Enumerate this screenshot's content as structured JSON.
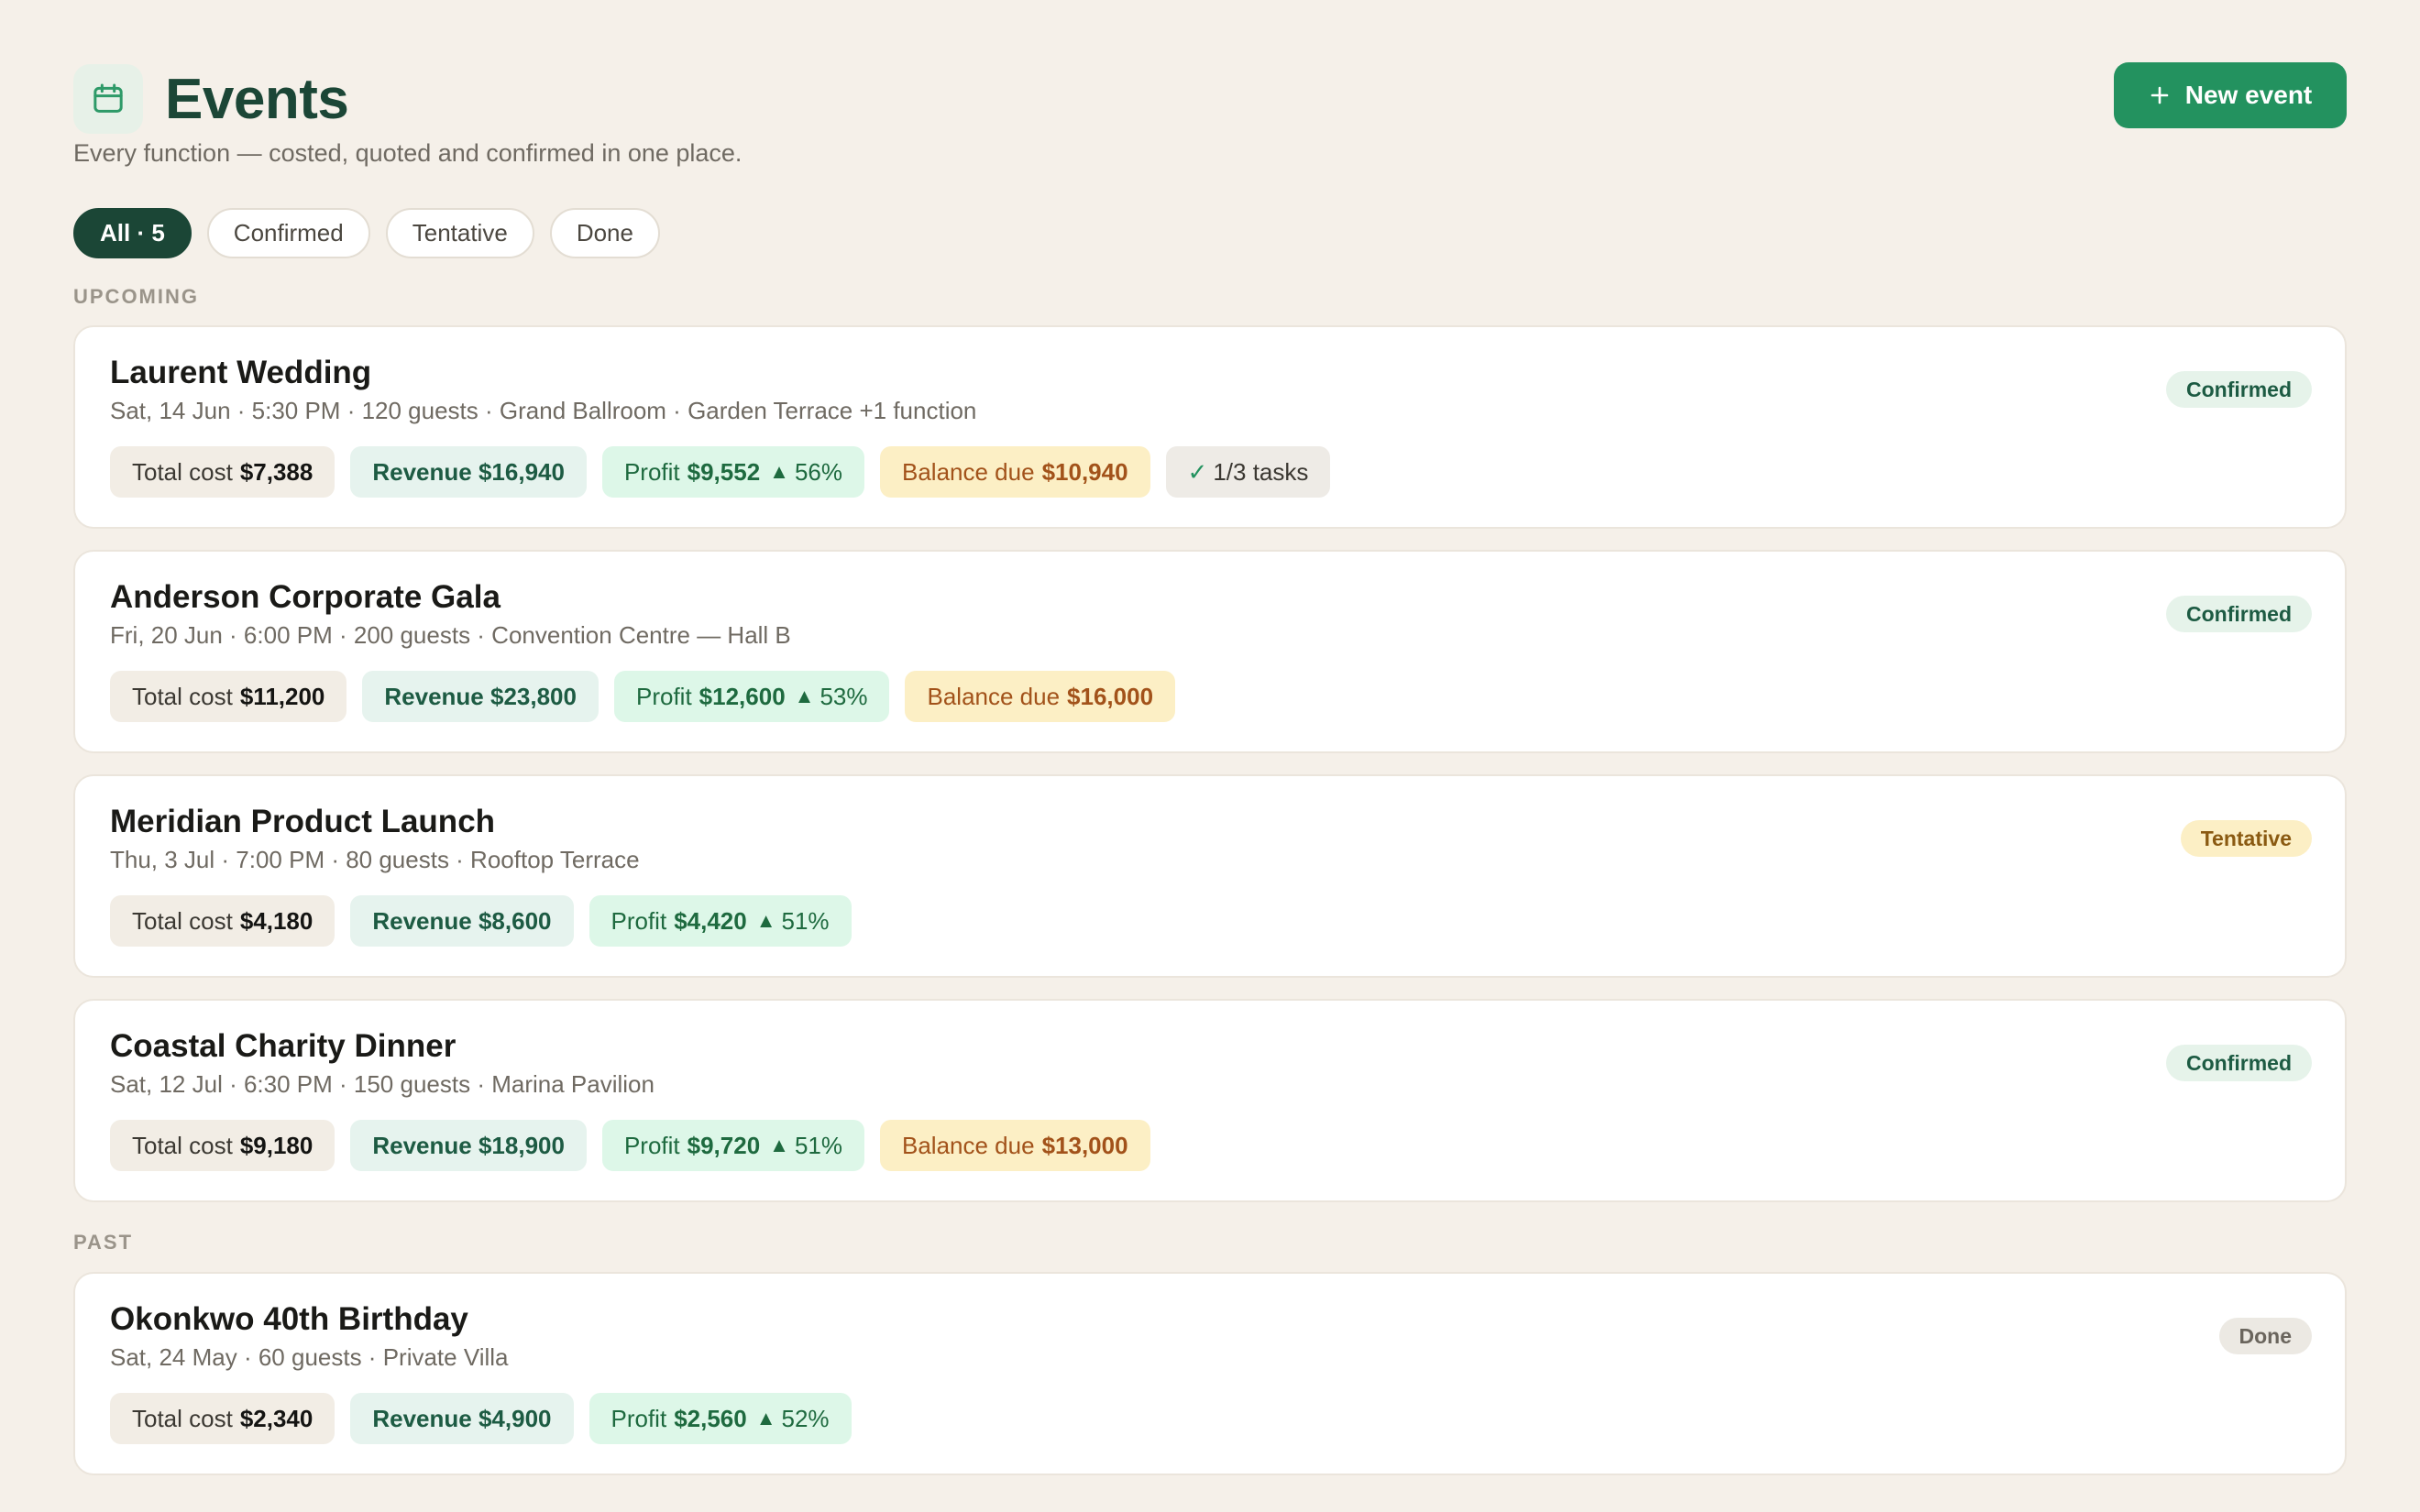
{
  "header": {
    "title": "Events",
    "subtitle": "Every function — costed, quoted and confirmed in one place.",
    "new_event_label": "New event",
    "icon": "calendar-icon"
  },
  "filters": [
    {
      "label": "All · 5",
      "active": true
    },
    {
      "label": "Confirmed",
      "active": false
    },
    {
      "label": "Tentative",
      "active": false
    },
    {
      "label": "Done",
      "active": false
    }
  ],
  "sections": {
    "upcoming": "UPCOMING",
    "past": "PAST"
  },
  "events": [
    {
      "title": "Laurent Wedding",
      "meta": "Sat, 14 Jun · 5:30 PM · 120 guests · Grand Ballroom · Garden Terrace +1 function",
      "status": "Confirmed",
      "cost_label": "Total cost",
      "cost": "$7,388",
      "revenue": "Revenue $16,940",
      "profit_label": "Profit",
      "profit": "$9,552",
      "margin": "56%",
      "balance_label": "Balance due",
      "balance": "$10,940",
      "tasks": "1/3 tasks"
    },
    {
      "title": "Anderson Corporate Gala",
      "meta": "Fri, 20 Jun · 6:00 PM · 200 guests · Convention Centre — Hall B",
      "status": "Confirmed",
      "cost_label": "Total cost",
      "cost": "$11,200",
      "revenue": "Revenue $23,800",
      "profit_label": "Profit",
      "profit": "$12,600",
      "margin": "53%",
      "balance_label": "Balance due",
      "balance": "$16,000"
    },
    {
      "title": "Meridian Product Launch",
      "meta": "Thu, 3 Jul · 7:00 PM · 80 guests · Rooftop Terrace",
      "status": "Tentative",
      "cost_label": "Total cost",
      "cost": "$4,180",
      "revenue": "Revenue $8,600",
      "profit_label": "Profit",
      "profit": "$4,420",
      "margin": "51%"
    },
    {
      "title": "Coastal Charity Dinner",
      "meta": "Sat, 12 Jul · 6:30 PM · 150 guests · Marina Pavilion",
      "status": "Confirmed",
      "cost_label": "Total cost",
      "cost": "$9,180",
      "revenue": "Revenue $18,900",
      "profit_label": "Profit",
      "profit": "$9,720",
      "margin": "51%",
      "balance_label": "Balance due",
      "balance": "$13,000"
    },
    {
      "title": "Okonkwo 40th Birthday",
      "meta": "Sat, 24 May · 60 guests · Private Villa",
      "status": "Done",
      "cost_label": "Total cost",
      "cost": "$2,340",
      "revenue": "Revenue $4,900",
      "profit_label": "Profit",
      "profit": "$2,560",
      "margin": "52%"
    }
  ],
  "colors": {
    "background": "#f5f0e9",
    "brand_dark": "#1b4636",
    "accent": "#23925f",
    "profit_bg": "#ddf7e8",
    "balance_bg": "#fcefc5"
  }
}
